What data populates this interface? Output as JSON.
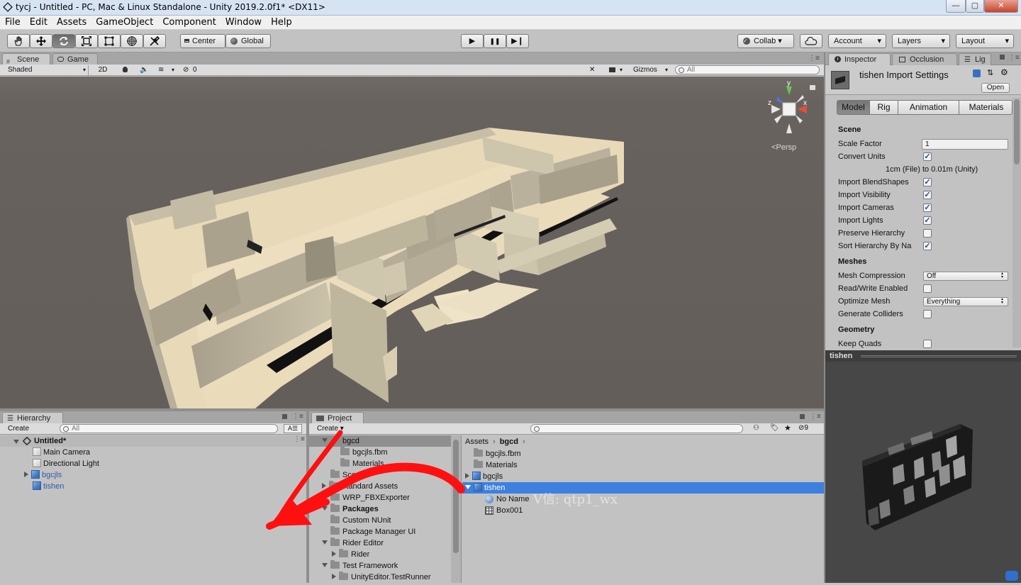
{
  "window": {
    "title": "tycj - Untitled - PC, Mac & Linux Standalone - Unity 2019.2.0f1* <DX11>",
    "min": "—",
    "max": "▢",
    "close": "✕"
  },
  "menu": [
    "File",
    "Edit",
    "Assets",
    "GameObject",
    "Component",
    "Window",
    "Help"
  ],
  "toolbar": {
    "tools": [
      "hand-icon",
      "move-icon",
      "rotate-icon",
      "scale-icon",
      "rect-icon",
      "transform-icon",
      "custom-tool-icon"
    ],
    "pivot": "Center",
    "space": "Global",
    "play": "▶",
    "pause": "❚❚",
    "step": "▶❙",
    "collab": "Collab ▾",
    "account": "Account",
    "layers": "Layers",
    "layout": "Layout"
  },
  "scene_view": {
    "tabs": [
      "Scene",
      "Game"
    ],
    "shading": "Shaded",
    "mode2d": "2D",
    "fx_count": "0",
    "gizmos": "Gizmos",
    "search_placeholder": "All",
    "axes": {
      "y": "y",
      "x": "x",
      "z": "z"
    },
    "projection": "Persp"
  },
  "inspector": {
    "tabs": [
      "Inspector",
      "Occlusion",
      "Lig"
    ],
    "title": "tishen Import Settings",
    "open": "Open",
    "subtabs": [
      "Model",
      "Rig",
      "Animation",
      "Materials"
    ],
    "section_scene": "Scene",
    "scale_factor_label": "Scale Factor",
    "scale_factor": "1",
    "convert_units_label": "Convert Units",
    "convert_units": true,
    "convert_units_note": "1cm (File) to 0.01m (Unity)",
    "options": [
      {
        "label": "Import BlendShapes",
        "checked": true
      },
      {
        "label": "Import Visibility",
        "checked": true
      },
      {
        "label": "Import Cameras",
        "checked": true
      },
      {
        "label": "Import Lights",
        "checked": true
      },
      {
        "label": "Preserve Hierarchy",
        "checked": false
      },
      {
        "label": "Sort Hierarchy By Na",
        "checked": true
      }
    ],
    "section_meshes": "Meshes",
    "mesh_compression_label": "Mesh Compression",
    "mesh_compression": "Off",
    "rw_label": "Read/Write Enabled",
    "rw": false,
    "optimize_label": "Optimize Mesh",
    "optimize": "Everything",
    "colliders_label": "Generate Colliders",
    "colliders": false,
    "section_geometry": "Geometry",
    "keep_quads_label": "Keep Quads",
    "keep_quads": false,
    "preview_title": "tishen"
  },
  "hierarchy": {
    "tab": "Hierarchy",
    "create": "Create ▾",
    "search_placeholder": "All",
    "scene": "Untitled*",
    "items": [
      "Main Camera",
      "Directional Light",
      "bgcjls",
      "tishen"
    ]
  },
  "project": {
    "tab": "Project",
    "create": "Create ▾",
    "badge": "9",
    "tree": [
      {
        "label": "bgcd",
        "indent": 0,
        "selected": true
      },
      {
        "label": "bgcjls.fbm",
        "indent": 1
      },
      {
        "label": "Materials",
        "indent": 1
      },
      {
        "label": "Scenes",
        "indent": 0
      },
      {
        "label": "Standard Assets",
        "indent": 0
      },
      {
        "label": "WRP_FBXExporter",
        "indent": 0
      },
      {
        "label": "Packages",
        "indent": 0,
        "bold": true
      },
      {
        "label": "Custom NUnit",
        "indent": 0
      },
      {
        "label": "Package Manager UI",
        "indent": 0
      },
      {
        "label": "Rider Editor",
        "indent": 0
      },
      {
        "label": "Rider",
        "indent": 1
      },
      {
        "label": "Test Framework",
        "indent": 0
      },
      {
        "label": "UnityEditor.TestRunner",
        "indent": 1
      }
    ],
    "breadcrumb": [
      "Assets",
      "bgcd"
    ],
    "files": [
      {
        "label": "bgcjls.fbm",
        "type": "folder"
      },
      {
        "label": "Materials",
        "type": "folder"
      },
      {
        "label": "bgcjls",
        "type": "model"
      },
      {
        "label": "tishen",
        "type": "model",
        "selected": true
      },
      {
        "label": "No Name",
        "type": "mesh",
        "indent": 1
      },
      {
        "label": "Box001",
        "type": "grid",
        "indent": 1
      }
    ]
  },
  "watermark": "V信: qtp1_wx",
  "colors": {
    "selection": "#3d80df",
    "arrow": "#ff1010"
  }
}
